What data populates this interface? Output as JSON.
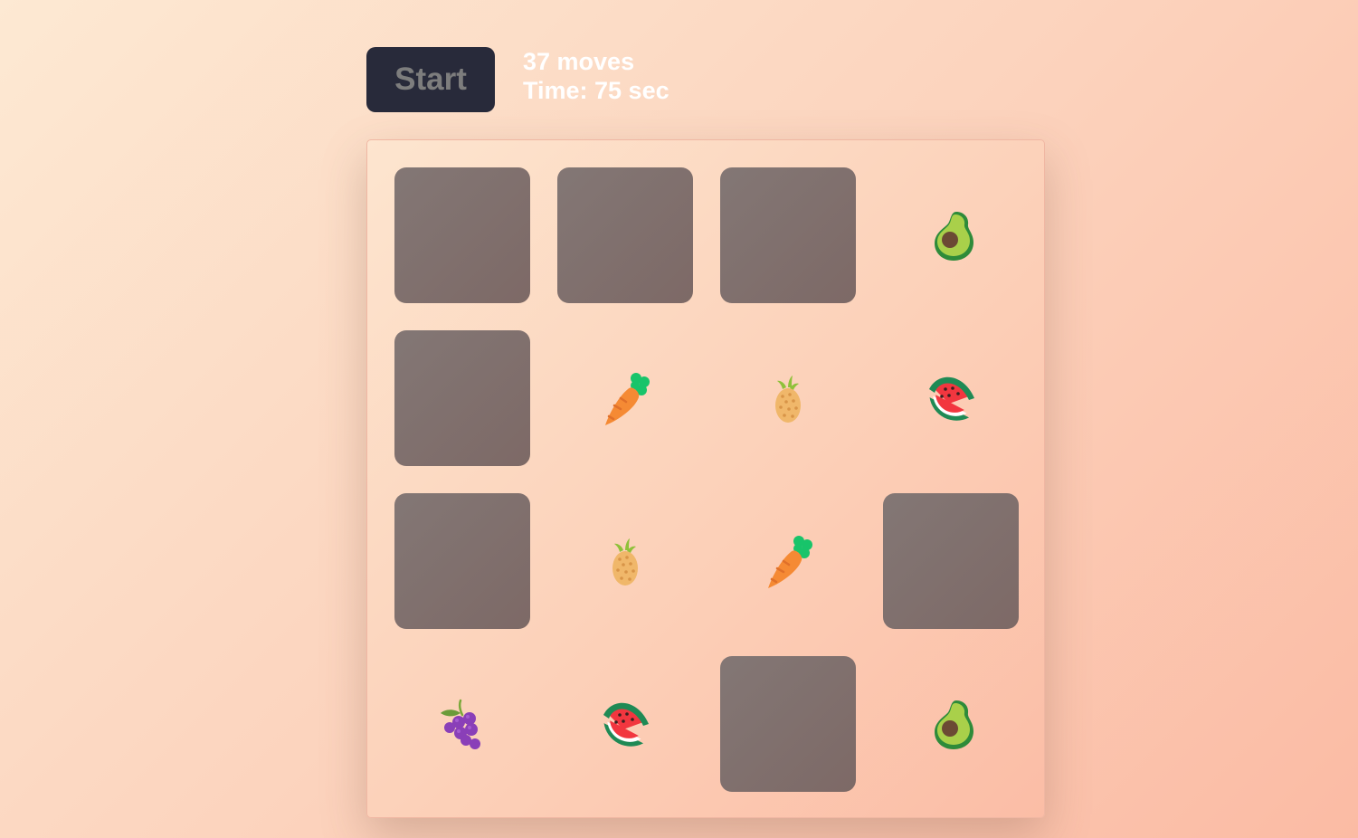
{
  "controls": {
    "start_label": "Start",
    "moves_text": "37 moves",
    "time_text": "Time: 75 sec"
  },
  "board": {
    "cards": [
      {
        "state": "hidden",
        "icon": null
      },
      {
        "state": "hidden",
        "icon": null
      },
      {
        "state": "hidden",
        "icon": null
      },
      {
        "state": "flipped",
        "icon": "avocado-icon"
      },
      {
        "state": "hidden",
        "icon": null
      },
      {
        "state": "flipped",
        "icon": "carrot-icon"
      },
      {
        "state": "flipped",
        "icon": "pineapple-icon"
      },
      {
        "state": "flipped",
        "icon": "watermelon-icon"
      },
      {
        "state": "hidden",
        "icon": null
      },
      {
        "state": "flipped",
        "icon": "pineapple-icon"
      },
      {
        "state": "flipped",
        "icon": "carrot-icon"
      },
      {
        "state": "hidden",
        "icon": null
      },
      {
        "state": "flipped",
        "icon": "grapes-icon"
      },
      {
        "state": "flipped",
        "icon": "watermelon-icon"
      },
      {
        "state": "hidden",
        "icon": null
      },
      {
        "state": "flipped",
        "icon": "avocado-icon"
      }
    ]
  },
  "colors": {
    "card_back": "#807371",
    "start_button_bg": "#282a3a",
    "start_button_text": "#7d7d7d",
    "stats_text": "#ffffff"
  }
}
